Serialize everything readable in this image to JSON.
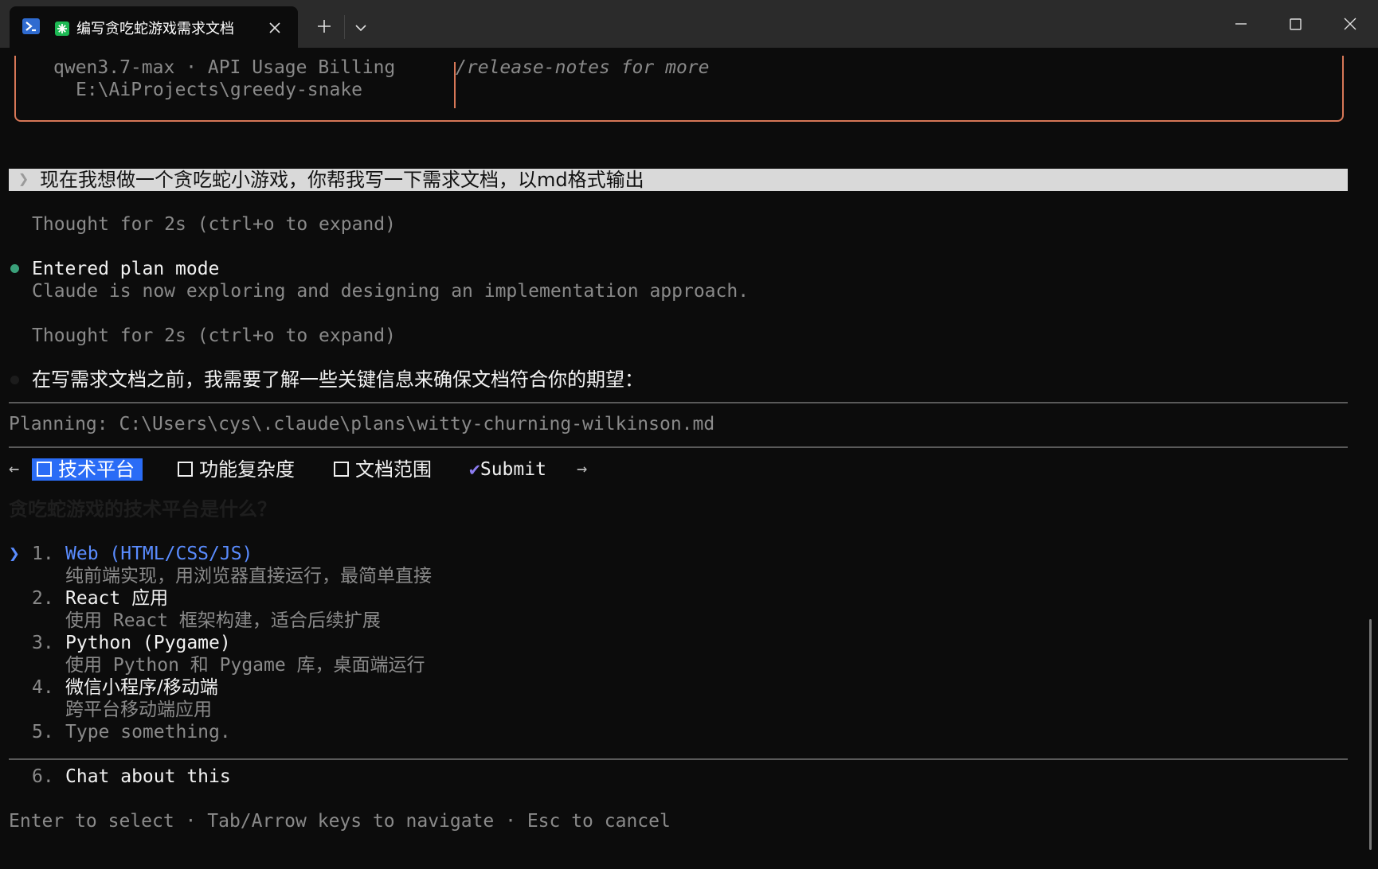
{
  "window": {
    "tab_title": "编写贪吃蛇游戏需求文档"
  },
  "icons": {
    "tab_shell": "powershell-icon",
    "tab_status": "spark-icon",
    "tab_close": "close-icon",
    "new_tab": "plus-icon",
    "tab_dropdown": "chevron-down-icon",
    "minimize": "minimize-icon",
    "maximize": "maximize-icon",
    "close": "close-icon"
  },
  "colors": {
    "background": "#0c0c0c",
    "box_border": "#d77757",
    "accent_blue": "#2a6cf6",
    "option_blue": "#5a8cff",
    "submit_check": "#8c7cf0",
    "bullet_green": "#3aa07a"
  },
  "welcome": {
    "model_line": "qwen3.7-max · API Usage Billing",
    "path_line": "E:\\AiProjects\\greedy-snake",
    "release_notes": "/release-notes for more"
  },
  "conversation": {
    "prompt_chevron": "❯",
    "user_prompt": "现在我想做一个贪吃蛇小游戏，你帮我写一下需求文档，以md格式输出",
    "thought_1": "Thought for 2s (ctrl+o to expand)",
    "plan_mode_title": "Entered plan mode",
    "plan_mode_desc": "Claude is now exploring and designing an implementation approach.",
    "thought_2": "Thought for 2s (ctrl+o to expand)",
    "assistant_msg": "在写需求文档之前，我需要了解一些关键信息来确保文档符合你的期望："
  },
  "planning": {
    "path": "Planning: C:\\Users\\cys\\.claude\\plans\\witty-churning-wilkinson.md"
  },
  "question_tabs": {
    "left_arrow": "←",
    "right_arrow": "→",
    "tabs": [
      {
        "label": "技术平台",
        "active": true
      },
      {
        "label": "功能复杂度",
        "active": false
      },
      {
        "label": "文档范围",
        "active": false
      }
    ],
    "submit_check": "✔",
    "submit_label": "Submit"
  },
  "question": {
    "text": "贪吃蛇游戏的技术平台是什么？",
    "cursor": "❯",
    "options": [
      {
        "num": "1.",
        "label": "Web (HTML/CSS/JS)",
        "desc": "纯前端实现，用浏览器直接运行，最简单直接"
      },
      {
        "num": "2.",
        "label": "React 应用",
        "desc": "使用 React 框架构建，适合后续扩展"
      },
      {
        "num": "3.",
        "label": "Python (Pygame)",
        "desc": "使用 Python 和 Pygame 库，桌面端运行"
      },
      {
        "num": "4.",
        "label": "微信小程序/移动端",
        "desc": "跨平台移动端应用"
      },
      {
        "num": "5.",
        "label": "Type something.",
        "desc": ""
      }
    ],
    "chat_option": {
      "num": "6.",
      "label": "Chat about this"
    }
  },
  "footer": {
    "hint": "Enter to select · Tab/Arrow keys to navigate · Esc to cancel"
  }
}
